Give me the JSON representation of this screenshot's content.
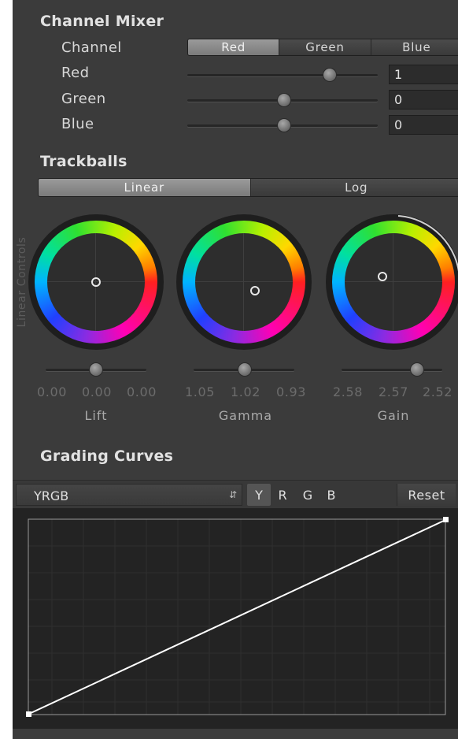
{
  "channel_mixer": {
    "title": "Channel Mixer",
    "channel_label": "Channel",
    "channels": [
      "Red",
      "Green",
      "Blue"
    ],
    "selected_channel": "Red",
    "rows": [
      {
        "label": "Red",
        "value": "1",
        "slider_fraction": 0.75
      },
      {
        "label": "Green",
        "value": "0",
        "slider_fraction": 0.5
      },
      {
        "label": "Blue",
        "value": "0",
        "slider_fraction": 0.5
      }
    ]
  },
  "trackballs": {
    "title": "Trackballs",
    "modes": [
      "Linear",
      "Log"
    ],
    "selected_mode": "Linear",
    "side_label": "Linear Controls",
    "wheels": [
      {
        "name": "Lift",
        "values": [
          "0.00",
          "0.00",
          "0.00"
        ],
        "slider_fraction": 0.5
      },
      {
        "name": "Gamma",
        "values": [
          "1.05",
          "1.02",
          "0.93"
        ],
        "slider_fraction": 0.5
      },
      {
        "name": "Gain",
        "values": [
          "2.58",
          "2.57",
          "2.52"
        ],
        "slider_fraction": 0.75
      }
    ]
  },
  "grading_curves": {
    "title": "Grading Curves",
    "curve_select": "YRGB",
    "channel_buttons": [
      "Y",
      "R",
      "G",
      "B"
    ],
    "selected_channel": "Y",
    "reset_label": "Reset"
  },
  "colors": {
    "panel_bg": "#3b3b3b",
    "active_segment": "#8a8a8a",
    "curve_line": "#ffffff"
  }
}
